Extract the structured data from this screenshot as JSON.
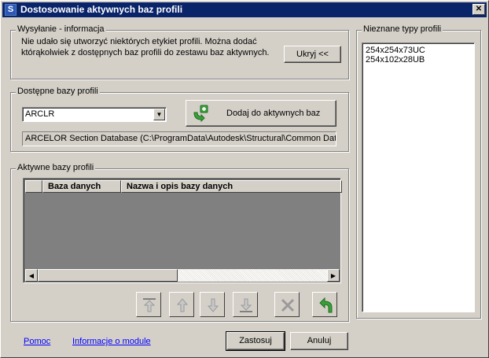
{
  "window": {
    "title": "Dostosowanie aktywnych baz profili",
    "close_glyph": "✕"
  },
  "info_group": {
    "legend": "Wysyłanie - informacja",
    "message": "Nie udało się utworzyć niektórych etykiet profili.  Można dodać którąkolwiek z dostępnych baz profili do zestawu baz aktywnych.",
    "hide_button": "Ukryj <<"
  },
  "available_group": {
    "legend": "Dostępne bazy profili",
    "selected_db": "ARCLR",
    "add_button": "Dodaj do aktywnych baz",
    "db_description": "ARCELOR Section Database (C:\\ProgramData\\Autodesk\\Structural\\Common Data"
  },
  "active_group": {
    "legend": "Aktywne bazy profili",
    "columns": [
      "",
      "Baza danych",
      "Nazwa i opis bazy danych"
    ],
    "rows": []
  },
  "toolbar_icons": [
    {
      "name": "move-top-icon",
      "enabled": false
    },
    {
      "name": "move-up-icon",
      "enabled": false
    },
    {
      "name": "move-down-icon",
      "enabled": false
    },
    {
      "name": "move-bottom-icon",
      "enabled": false
    },
    {
      "name": "delete-icon",
      "enabled": false
    },
    {
      "name": "undo-icon",
      "enabled": true
    }
  ],
  "unknown_group": {
    "legend": "Nieznane typy profili",
    "items": [
      "254x254x73UC",
      "254x102x28UB"
    ]
  },
  "footer": {
    "help_link": "Pomoc",
    "module_info_link": "Informacje o module",
    "apply_button": "Zastosuj",
    "cancel_button": "Anuluj"
  },
  "colors": {
    "titlebar": "#0a246a",
    "window": "#d4d0c8",
    "link": "#0000ff",
    "add_icon_green": "#3aa03a"
  }
}
